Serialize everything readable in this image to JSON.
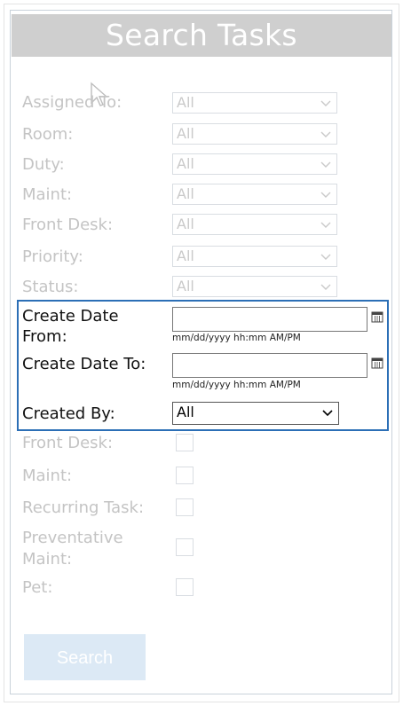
{
  "title": "Search Tasks",
  "filters": [
    {
      "label": "Assigned To:",
      "value": "All"
    },
    {
      "label": "Room:",
      "value": "All"
    },
    {
      "label": "Duty:",
      "value": "All"
    },
    {
      "label": "Maint:",
      "value": "All"
    },
    {
      "label": "Front Desk:",
      "value": "All"
    },
    {
      "label": "Priority:",
      "value": "All"
    },
    {
      "label": "Status:",
      "value": "All"
    }
  ],
  "create_date_from": {
    "label_line1": "Create Date",
    "label_line2": "From:",
    "value": "",
    "hint": "mm/dd/yyyy hh:mm AM/PM"
  },
  "create_date_to": {
    "label": "Create Date To:",
    "value": "",
    "hint": "mm/dd/yyyy hh:mm AM/PM"
  },
  "created_by": {
    "label": "Created By:",
    "value": "All"
  },
  "checkboxes": [
    {
      "label": "Front Desk:"
    },
    {
      "label": "Maint:"
    },
    {
      "label": "Recurring Task:"
    },
    {
      "label_line1": "Preventative",
      "label_line2": "Maint:"
    },
    {
      "label": "Pet:"
    }
  ],
  "search_button": "Search",
  "colors": {
    "accent_border": "#2c6fb6",
    "title_bg": "#cfcfcf",
    "disabled_text": "#c4c4c4",
    "button_bg": "#dce9f5"
  }
}
